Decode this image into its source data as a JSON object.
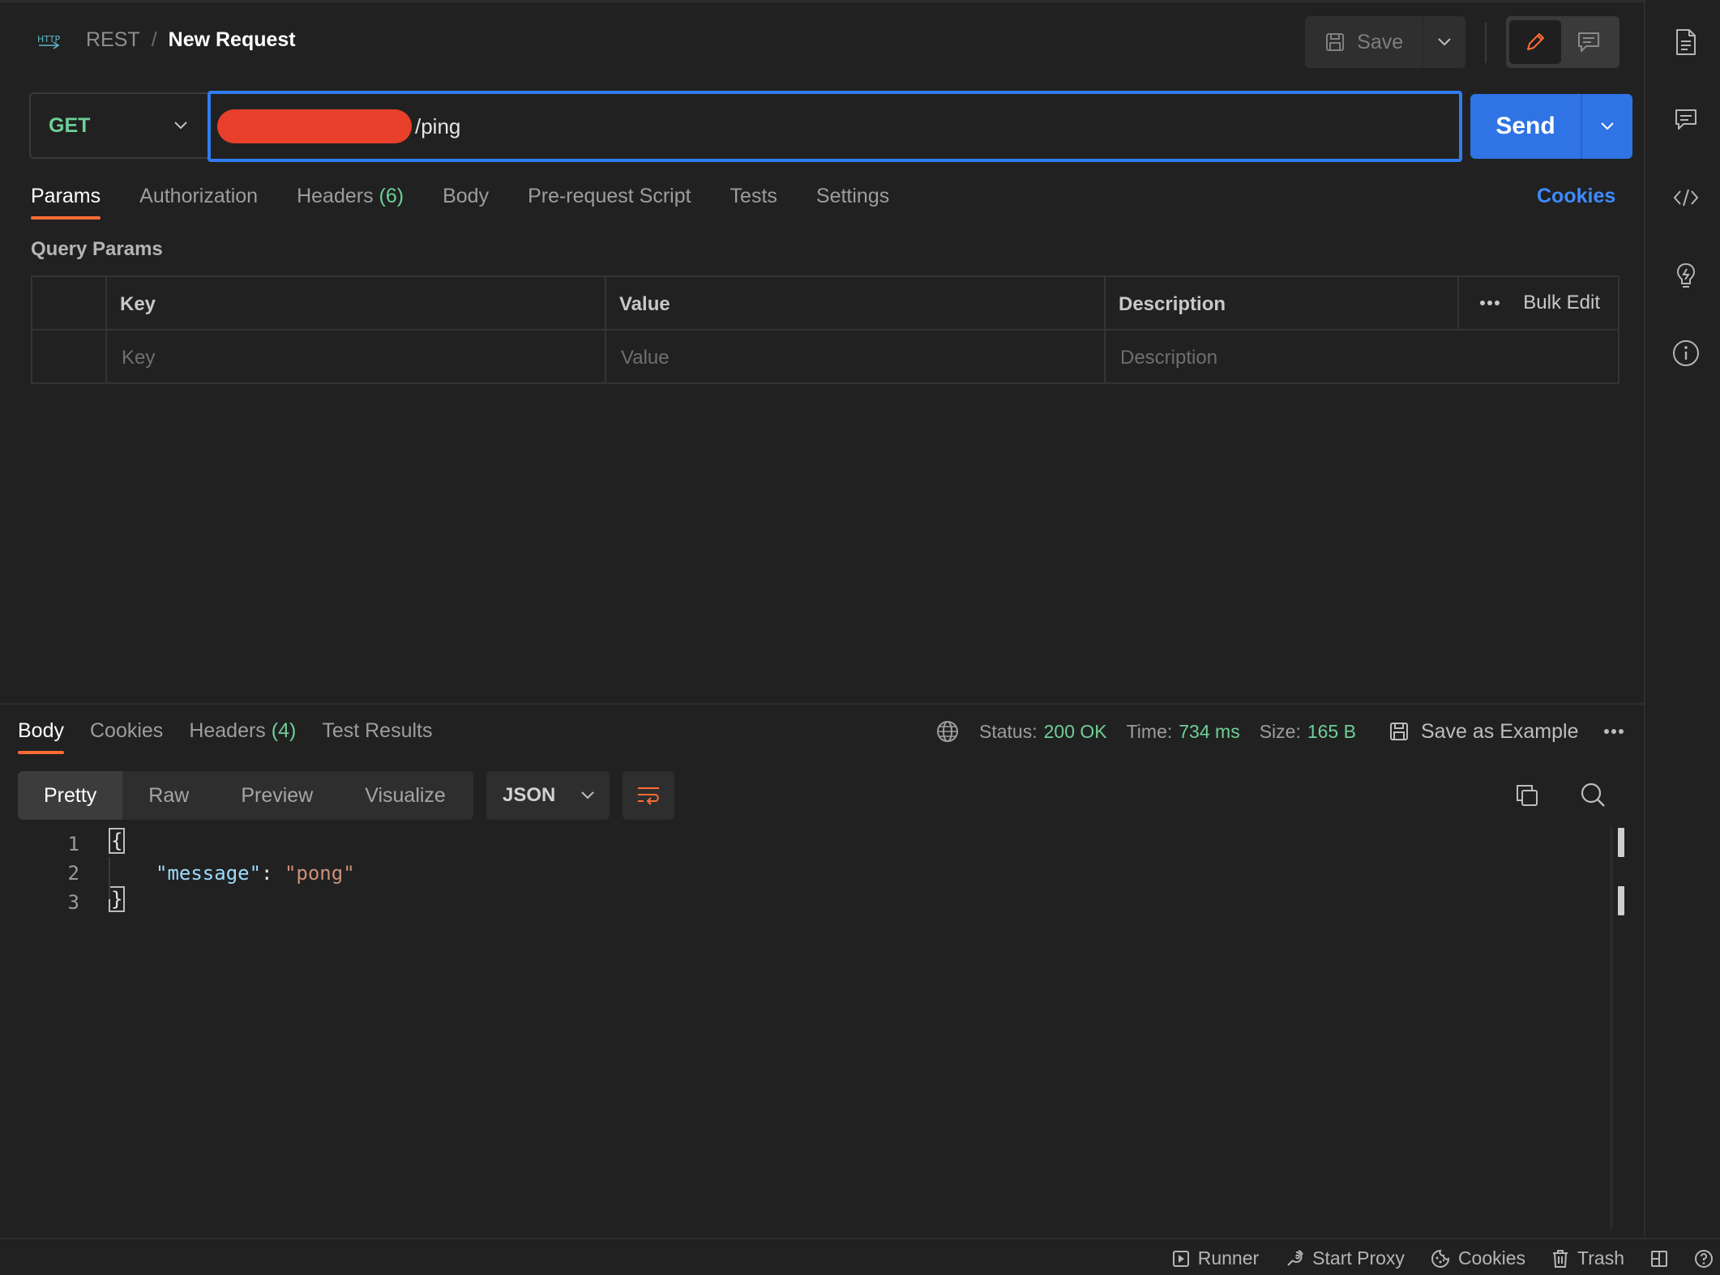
{
  "header": {
    "icon": "http-icon",
    "collection": "REST",
    "separator": "/",
    "title": "New Request",
    "save_label": "Save"
  },
  "request": {
    "method": "GET",
    "url_visible": "/ping",
    "send_label": "Send"
  },
  "request_tabs": [
    {
      "label": "Params",
      "active": true
    },
    {
      "label": "Authorization"
    },
    {
      "label": "Headers",
      "count": "(6)"
    },
    {
      "label": "Body"
    },
    {
      "label": "Pre-request Script"
    },
    {
      "label": "Tests"
    },
    {
      "label": "Settings"
    }
  ],
  "cookies_link": "Cookies",
  "query_params": {
    "title": "Query Params",
    "columns": [
      "Key",
      "Value",
      "Description"
    ],
    "bulk_edit": "Bulk Edit",
    "placeholders": {
      "key": "Key",
      "value": "Value",
      "description": "Description"
    }
  },
  "response_tabs": [
    {
      "label": "Body",
      "active": true
    },
    {
      "label": "Cookies"
    },
    {
      "label": "Headers",
      "count": "(4)"
    },
    {
      "label": "Test Results"
    }
  ],
  "response_meta": {
    "status_label": "Status:",
    "status_value": "200 OK",
    "time_label": "Time:",
    "time_value": "734 ms",
    "size_label": "Size:",
    "size_value": "165 B",
    "save_example": "Save as Example"
  },
  "format_tabs": [
    "Pretty",
    "Raw",
    "Preview",
    "Visualize"
  ],
  "language": "JSON",
  "code_lines": [
    {
      "num": "1",
      "text": "{"
    },
    {
      "num": "2",
      "key": "\"message\"",
      "colon": ": ",
      "value": "\"pong\""
    },
    {
      "num": "3",
      "text": "}"
    }
  ],
  "statusbar": {
    "runner": "Runner",
    "proxy": "Start Proxy",
    "cookies": "Cookies",
    "trash": "Trash"
  },
  "colors": {
    "accent_orange": "#ff6c37",
    "send_blue": "#2f73e4",
    "link_blue": "#3d8bff",
    "method_green": "#6fcf97",
    "redaction_red": "#e8402a"
  }
}
